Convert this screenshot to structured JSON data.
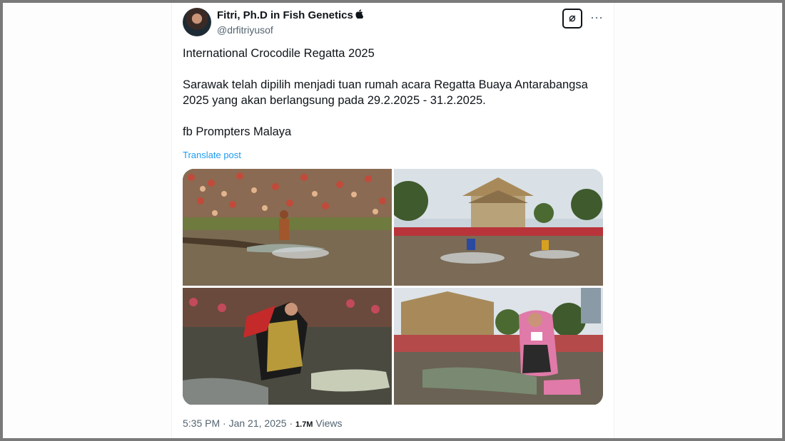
{
  "tweet": {
    "author": {
      "name": "Fitri, Ph.D in Fish Genetics",
      "handle": "@drfitriyusof",
      "badge_icon": "apple-icon"
    },
    "text": {
      "line1": "International Crocodile Regatta 2025",
      "line2": "Sarawak telah dipilih menjadi tuan rumah acara Regatta Buaya Antarabangsa 2025 yang akan berlangsung pada 29.2.2025 - 31.2.2025.",
      "line3": "fb Prompters Malaya"
    },
    "translate_label": "Translate post",
    "media": [
      {
        "name": "photo-crowd-crocodile-rider",
        "icon": "image-icon"
      },
      {
        "name": "photo-building-crocodile-race",
        "icon": "image-icon"
      },
      {
        "name": "photo-costumed-rider",
        "icon": "image-icon"
      },
      {
        "name": "photo-hijab-rider-number-11",
        "icon": "image-icon"
      }
    ],
    "meta": {
      "time": "5:35 PM",
      "separator": "·",
      "date": "Jan 21, 2025",
      "views_count": "1.7M",
      "views_label": "Views"
    }
  },
  "actions": {
    "grok_icon": "grok-icon",
    "grok_glyph": "⌀",
    "more_icon": "more-icon",
    "more_glyph": "···"
  },
  "colors": {
    "link": "#1d9bf0",
    "secondary_text": "#536471",
    "primary_text": "#0f1419"
  }
}
